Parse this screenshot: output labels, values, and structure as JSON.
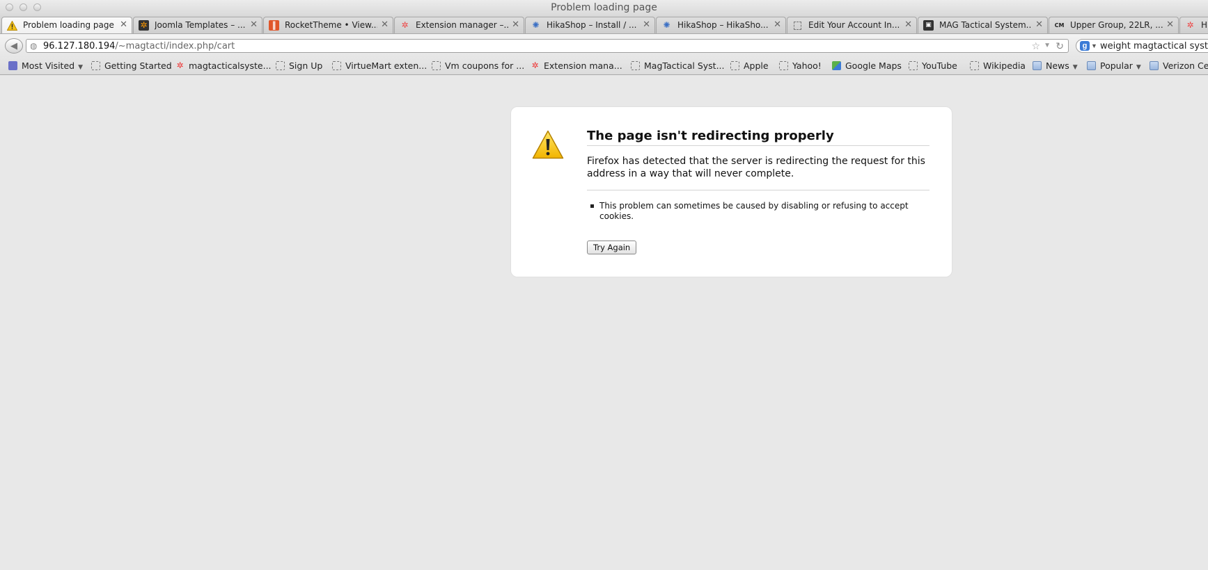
{
  "window": {
    "title": "Problem loading page"
  },
  "tabs": [
    {
      "label": "Problem loading page",
      "icon": "warning-icon",
      "active": true
    },
    {
      "label": "Joomla Templates – ...",
      "icon": "joomla-icon"
    },
    {
      "label": "RocketTheme • View...",
      "icon": "rockettheme-icon"
    },
    {
      "label": "Extension manager –...",
      "icon": "joomla-icon"
    },
    {
      "label": "HikaShop – Install / ...",
      "icon": "hikashop-icon"
    },
    {
      "label": "HikaShop – HikaSho...",
      "icon": "hikashop-icon"
    },
    {
      "label": "Edit Your Account In...",
      "icon": "blank-page-icon"
    },
    {
      "label": "MAG Tactical System...",
      "icon": "mag-tactical-icon"
    },
    {
      "label": "Upper Group, 22LR, ...",
      "icon": "cmmg-icon"
    },
    {
      "label": "Hik",
      "icon": "joomla-icon"
    }
  ],
  "nav": {
    "url_host": "96.127.180.194",
    "url_path": "/~magtacti/index.php/cart",
    "search_value": "weight magtactical system"
  },
  "bookmarks": [
    {
      "label": "Most Visited",
      "icon": "most-visited-icon",
      "dropdown": true
    },
    {
      "label": "Getting Started",
      "icon": "blank-page-icon"
    },
    {
      "label": "magtacticalsyste...",
      "icon": "joomla-icon"
    },
    {
      "label": "Sign Up",
      "icon": "blank-page-icon"
    },
    {
      "label": "VirtueMart exten...",
      "icon": "blank-page-icon"
    },
    {
      "label": "Vm coupons for ...",
      "icon": "blank-page-icon"
    },
    {
      "label": "Extension mana...",
      "icon": "joomla-icon"
    },
    {
      "label": "MagTactical Syst...",
      "icon": "blank-page-icon"
    },
    {
      "label": "Apple",
      "icon": "blank-page-icon"
    },
    {
      "label": "Yahoo!",
      "icon": "blank-page-icon"
    },
    {
      "label": "Google Maps",
      "icon": "google-maps-icon"
    },
    {
      "label": "YouTube",
      "icon": "blank-page-icon"
    },
    {
      "label": "Wikipedia",
      "icon": "blank-page-icon"
    },
    {
      "label": "News",
      "icon": "folder-icon",
      "dropdown": true
    },
    {
      "label": "Popular",
      "icon": "folder-icon",
      "dropdown": true
    },
    {
      "label": "Verizon Cen",
      "icon": "folder-icon"
    }
  ],
  "error": {
    "title": "The page isn't redirecting properly",
    "description": "Firefox has detected that the server is redirecting the request for this address in a way that will never complete.",
    "bullets": [
      "This problem can sometimes be caused by disabling or refusing to accept cookies."
    ],
    "try_again_label": "Try Again"
  }
}
